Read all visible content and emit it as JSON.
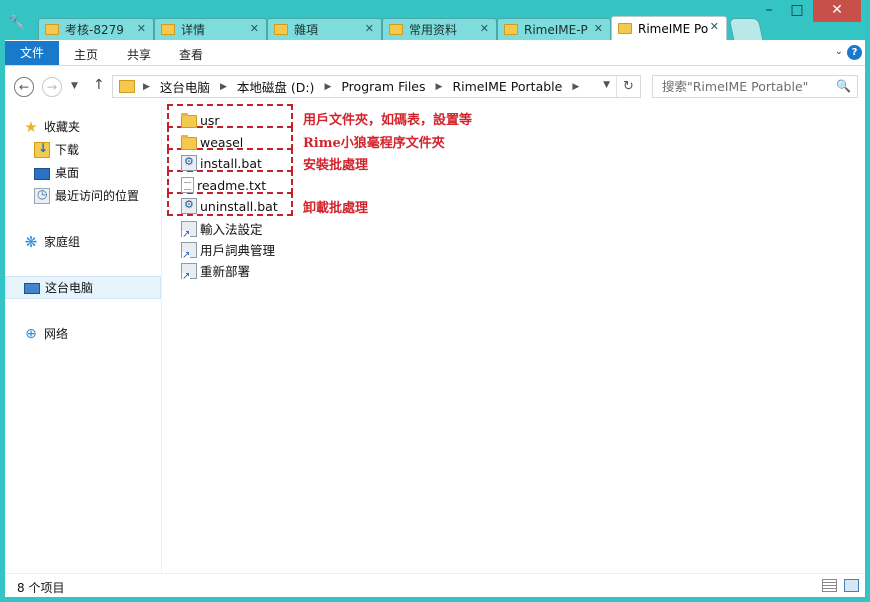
{
  "tabs": [
    {
      "label": "考核-8279"
    },
    {
      "label": "详情"
    },
    {
      "label": "雜項"
    },
    {
      "label": "常用资料"
    },
    {
      "label": "RimeIME-P"
    },
    {
      "label": "RimeIME Po"
    }
  ],
  "active_tab_index": 5,
  "ribbon": {
    "file": "文件",
    "home": "主页",
    "share": "共享",
    "view": "查看"
  },
  "address": {
    "crumbs": [
      "这台电脑",
      "本地磁盘 (D:)",
      "Program Files",
      "RimeIME Portable"
    ]
  },
  "search": {
    "placeholder": "搜索\"RimeIME Portable\""
  },
  "nav": {
    "favorites": "收藏夹",
    "downloads": "下载",
    "desktop": "桌面",
    "recent": "最近访问的位置",
    "homegroup": "家庭组",
    "this_pc": "这台电脑",
    "network": "网络"
  },
  "files": [
    {
      "name": "usr",
      "type": "folder"
    },
    {
      "name": "weasel",
      "type": "folder"
    },
    {
      "name": "install.bat",
      "type": "bat"
    },
    {
      "name": "readme.txt",
      "type": "txt"
    },
    {
      "name": "uninstall.bat",
      "type": "bat"
    },
    {
      "name": "輸入法設定",
      "type": "shortcut"
    },
    {
      "name": "用戶詞典管理",
      "type": "shortcut"
    },
    {
      "name": "重新部署",
      "type": "shortcut"
    }
  ],
  "annotations": {
    "usr": "用戶文件夾，如碼表，設置等",
    "weasel": "Rime小狼毫程序文件夾",
    "install": "安裝批處理",
    "uninstall": "卸載批處理"
  },
  "status": {
    "count": "8 个项目"
  },
  "colors": {
    "frame": "#35c4c4",
    "accent": "#1979ca",
    "annotation": "#d2242c",
    "close": "#c7504a"
  }
}
